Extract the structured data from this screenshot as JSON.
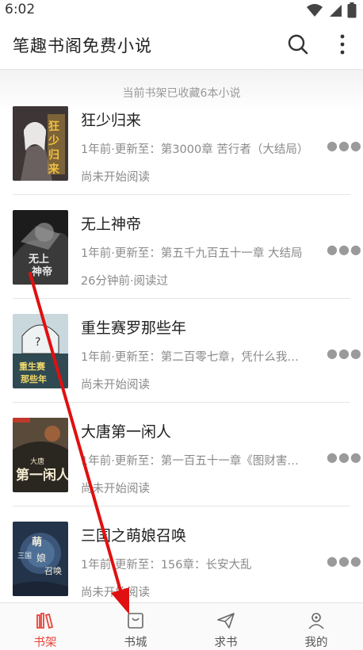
{
  "status": {
    "time": "6:02"
  },
  "header": {
    "title": "笔趣书阁免费小说"
  },
  "shelf_notice": "当前书架已收藏6本小说",
  "books": [
    {
      "title": "狂少归来",
      "update": "1年前·更新至：第3000章 苦行者（大结局）",
      "read_status": "尚未开始阅读",
      "cover_text": "狂少归来"
    },
    {
      "title": "无上神帝",
      "update": "1年前·更新至：第五千九百五十一章 大结局",
      "read_status": "26分钟前·阅读过",
      "cover_text": "无上神帝"
    },
    {
      "title": "重生赛罗那些年",
      "update": "1年前·更新至：第二百零七章，凭什么我…",
      "read_status": "尚未开始阅读",
      "cover_text": "重生赛罗那些年"
    },
    {
      "title": "大唐第一闲人",
      "update": "1年前·更新至：第一百五十一章《图财害…",
      "read_status": "尚未开始阅读",
      "cover_text": "大唐第一闲人"
    },
    {
      "title": "三国之萌娘召唤",
      "update": "1年前·更新至：156章：长安大乱",
      "read_status": "尚未开始阅读",
      "cover_text": "萌娘召唤"
    }
  ],
  "tabs": [
    {
      "label": "书架",
      "icon": "bookshelf-icon",
      "active": true
    },
    {
      "label": "书城",
      "icon": "store-bag-icon",
      "active": false
    },
    {
      "label": "求书",
      "icon": "paper-plane-icon",
      "active": false
    },
    {
      "label": "我的",
      "icon": "user-icon",
      "active": false
    }
  ],
  "colors": {
    "accent": "#e8443a",
    "arrow": "#e01010"
  }
}
